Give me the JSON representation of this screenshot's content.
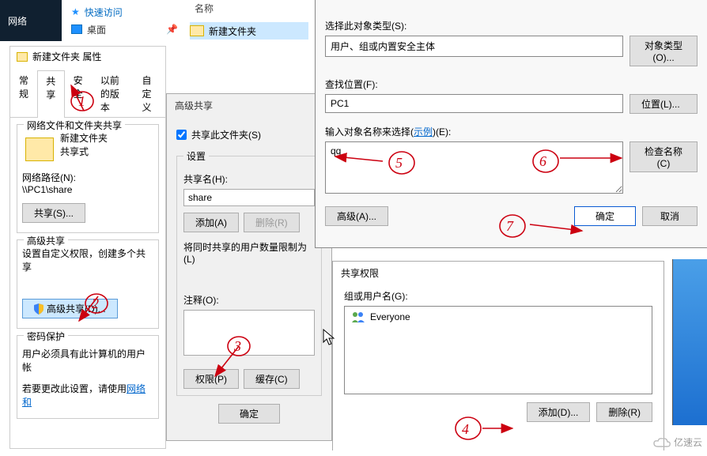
{
  "explorer": {
    "network_label": "网络",
    "quick_access": "快速访问",
    "desktop": "桌面",
    "column_name": "名称",
    "folder_name": "新建文件夹"
  },
  "properties": {
    "title": "新建文件夹 属性",
    "tabs": {
      "general": "常规",
      "share": "共享",
      "security": "安全",
      "prev": "以前的版本",
      "custom": "自定义"
    },
    "group1_title": "网络文件和文件夹共享",
    "folder_name": "新建文件夹",
    "share_style": "共享式",
    "netpath_label": "网络路径(N):",
    "netpath_value": "\\\\PC1\\share",
    "share_btn": "共享(S)...",
    "group2_title": "高级共享",
    "group2_desc": "设置自定义权限，创建多个共享",
    "adv_btn": "高级共享(D)...",
    "group3_title": "密码保护",
    "pw_line1": "用户必须具有此计算机的用户帐",
    "pw_line2_a": "若要更改此设置，请使用",
    "pw_link": "网络和"
  },
  "adv_share": {
    "title": "高级共享",
    "checkbox": "共享此文件夹(S)",
    "settings": "设置",
    "share_name_label": "共享名(H):",
    "share_name_value": "share",
    "add_btn": "添加(A)",
    "del_btn": "删除(R)",
    "limit_label": "将同时共享的用户数量限制为(L)",
    "comment_label": "注释(O):",
    "perm_btn": "权限(P)",
    "cache_btn": "缓存(C)",
    "ok_btn": "确定"
  },
  "select_users": {
    "obj_type_label": "选择此对象类型(S):",
    "obj_type_value": "用户、组或内置安全主体",
    "obj_type_btn": "对象类型(O)...",
    "location_label": "查找位置(F):",
    "location_value": "PC1",
    "location_btn": "位置(L)...",
    "names_label_a": "输入对象名称来选择(",
    "names_link": "示例",
    "names_label_b": ")(E):",
    "names_value": "qq",
    "check_btn": "检查名称(C)",
    "adv_btn": "高级(A)...",
    "ok_btn": "确定",
    "cancel_btn": "取消"
  },
  "permissions": {
    "title": "共享权限",
    "group_label": "组或用户名(G):",
    "list": {
      "item0": "Everyone"
    },
    "add_btn": "添加(D)...",
    "remove_btn": "删除(R)"
  },
  "watermark": "亿速云",
  "annotations": {
    "n1": "1",
    "n2": "2",
    "n3": "3",
    "n4": "4",
    "n5": "5",
    "n6": "6",
    "n7": "7"
  }
}
